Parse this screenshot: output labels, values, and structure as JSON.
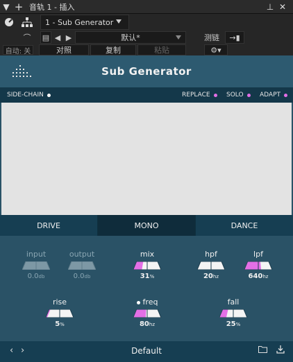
{
  "titlebar": {
    "title": "音轨 1 - 插入"
  },
  "toolbar": {
    "plugin_select": "1 - Sub Generator",
    "preset_select": "默认*",
    "compare_label": "对照",
    "copy_label": "复制",
    "paste_label": "粘贴",
    "sidechain_label": "测链",
    "auto_label": "自动: 关"
  },
  "plugin": {
    "title": "Sub Generator",
    "sidechain_label": "SIDE-CHAIN",
    "replace_label": "REPLACE",
    "solo_label": "SOLO",
    "adapt_label": "ADAPT",
    "modes": [
      "DRIVE",
      "MONO",
      "DANCE"
    ],
    "active_mode": "MONO",
    "accent_color": "#e36fe6",
    "bg_color": "#2a5266"
  },
  "knobs": {
    "input": {
      "label": "input",
      "value": "0.0",
      "unit": "db"
    },
    "output": {
      "label": "output",
      "value": "0.0",
      "unit": "db"
    },
    "mix": {
      "label": "mix",
      "value": "31",
      "unit": "%",
      "fill": 0.31
    },
    "hpf": {
      "label": "hpf",
      "value": "20",
      "unit": "hz",
      "fill": 0.0
    },
    "lpf": {
      "label": "lpf",
      "value": "640",
      "unit": "hz",
      "fill": 0.6
    },
    "rise": {
      "label": "rise",
      "value": "5",
      "unit": "%",
      "fill": 0.05
    },
    "freq": {
      "label": "freq",
      "value": "80",
      "unit": "hz",
      "fill": 0.45
    },
    "fall": {
      "label": "fall",
      "value": "25",
      "unit": "%",
      "fill": 0.25
    }
  },
  "footer": {
    "preset_name": "Default"
  }
}
